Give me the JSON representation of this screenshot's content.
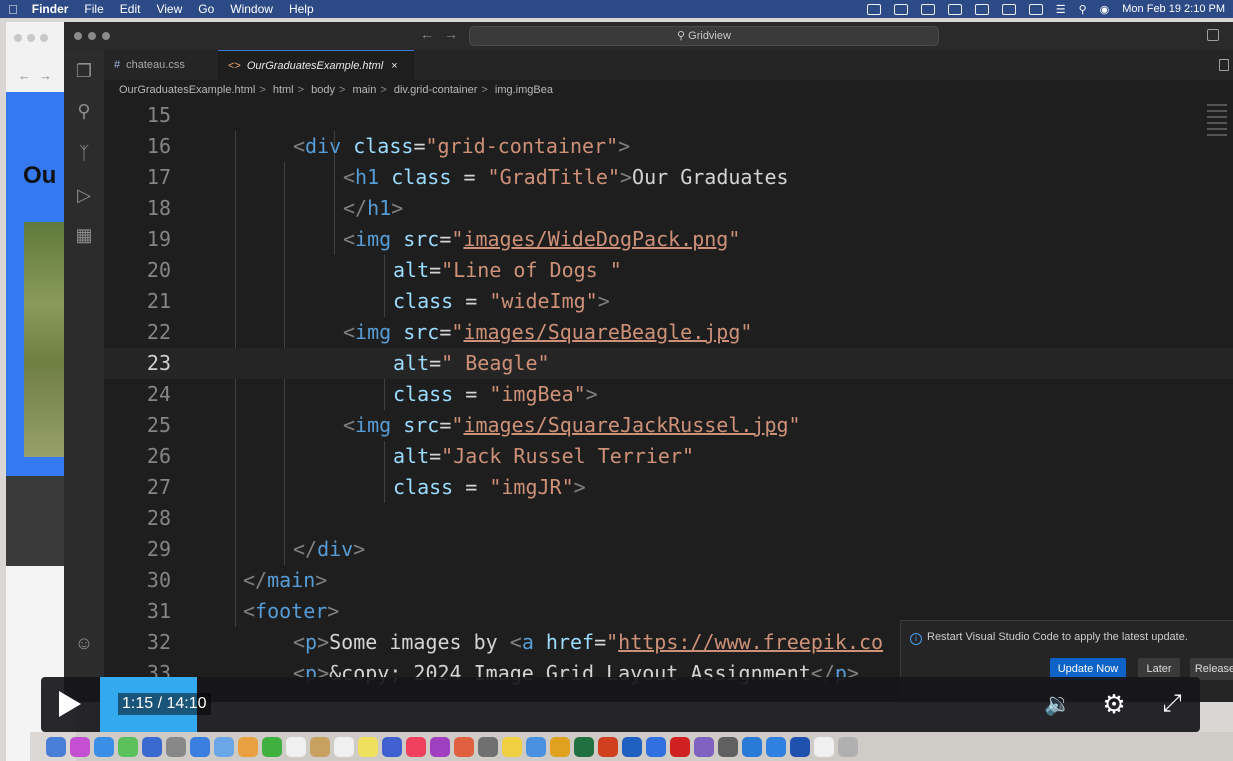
{
  "menubar": {
    "app_name": "Finder",
    "items": [
      "File",
      "Edit",
      "View",
      "Go",
      "Window",
      "Help"
    ],
    "datetime": "Mon Feb 19  2:10 PM"
  },
  "background_browser": {
    "heading_partial": "Ou"
  },
  "vscode": {
    "command_center": "Gridview",
    "tabs": [
      {
        "icon": "#",
        "label": "chateau.css"
      },
      {
        "icon": "<>",
        "label": "OurGraduatesExample.html",
        "close": "×"
      }
    ],
    "breadcrumb": [
      "OurGraduatesExample.html",
      "html",
      "body",
      "main",
      "div.grid-container",
      "img.imgBea"
    ],
    "current_line": 23,
    "lines": [
      {
        "n": "15"
      },
      {
        "n": "16"
      },
      {
        "n": "17"
      },
      {
        "n": "18"
      },
      {
        "n": "19"
      },
      {
        "n": "20"
      },
      {
        "n": "21"
      },
      {
        "n": "22"
      },
      {
        "n": "23"
      },
      {
        "n": "24"
      },
      {
        "n": "25"
      },
      {
        "n": "26"
      },
      {
        "n": "27"
      },
      {
        "n": "28"
      },
      {
        "n": "29"
      },
      {
        "n": "30"
      },
      {
        "n": "31"
      },
      {
        "n": "32"
      },
      {
        "n": "33"
      }
    ],
    "code": {
      "l16": {
        "tag": "div",
        "attr": "class",
        "val": "\"grid-container\""
      },
      "l17": {
        "tag": "h1",
        "attr": "class",
        "val": "\"GradTitle\"",
        "text": "Our Graduates"
      },
      "l18": {
        "tag": "h1"
      },
      "l19": {
        "tag": "img",
        "attr": "src",
        "val": "images/WideDogPack.png"
      },
      "l20": {
        "attr": "alt",
        "val": "\"Line of Dogs \""
      },
      "l21": {
        "attr": "class",
        "val": "\"wideImg\""
      },
      "l22": {
        "tag": "img",
        "attr": "src",
        "val": "images/SquareBeagle.jpg"
      },
      "l23": {
        "attr": "alt",
        "val": "\" Beagle\""
      },
      "l24": {
        "attr": "class",
        "val": "\"imgBea\""
      },
      "l25": {
        "tag": "img",
        "attr": "src",
        "val": "images/SquareJackRussel.jpg"
      },
      "l26": {
        "attr": "alt",
        "val": "\"Jack Russel Terrier\""
      },
      "l27": {
        "attr": "class",
        "val": "\"imgJR\""
      },
      "l29": {
        "tag": "div"
      },
      "l30": {
        "tag": "main"
      },
      "l31": {
        "tag": "footer"
      },
      "l32": {
        "tag": "p",
        "text": "Some images by ",
        "tag2": "a",
        "attr": "href",
        "val": "https://www.freepik.co"
      },
      "l33": {
        "tag": "p",
        "text": "&copy; 2024 Image Grid Layout Assignment",
        "close": "p"
      }
    },
    "notification": {
      "message": "Restart Visual Studio Code to apply the latest update.",
      "primary_button": "Update Now",
      "later_button": "Later",
      "release_button": "Release"
    }
  },
  "player": {
    "time": "1:15 / 14:10",
    "progress": 0.0882
  },
  "colors": {
    "accent": "#33aaf0",
    "tag": "#569cd6",
    "attr": "#9cdcfe",
    "string": "#ce9178",
    "primary_button": "#0e63c9"
  }
}
